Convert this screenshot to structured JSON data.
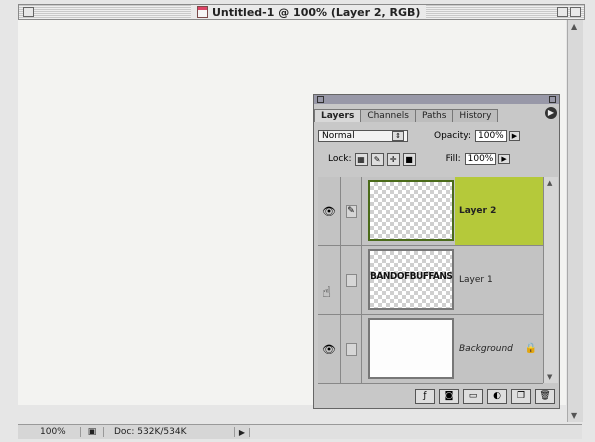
{
  "window": {
    "title": "Untitled-1 @ 100% (Layer 2, RGB)"
  },
  "statusbar": {
    "zoom": "100%",
    "doc": "Doc: 532K/534K",
    "arrow": "▶"
  },
  "palette": {
    "tabs": [
      "Layers",
      "Channels",
      "Paths",
      "History"
    ],
    "blend_mode": "Normal",
    "opacity_label": "Opacity:",
    "opacity_value": "100%",
    "lock_label": "Lock:",
    "fill_label": "Fill:",
    "fill_value": "100%",
    "layers": [
      {
        "name": "Layer 2",
        "selected": true,
        "visible": true,
        "thumb_text": ""
      },
      {
        "name": "Layer 1",
        "selected": false,
        "visible": false,
        "thumb_text": "BANDOFBUFFANS"
      },
      {
        "name": "Background",
        "selected": false,
        "visible": true,
        "locked": true,
        "thumb_text": ""
      }
    ]
  },
  "colors": {
    "selected_layer": "#b5c93a"
  },
  "icons": [
    "eye-icon",
    "brush-icon",
    "lock-icon",
    "hand-cursor-icon",
    "palette-menu-icon"
  ]
}
